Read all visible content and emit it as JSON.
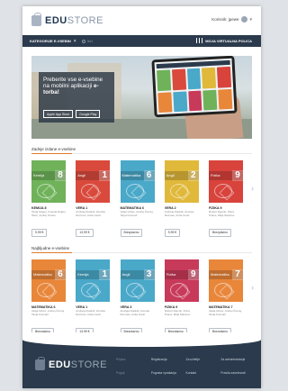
{
  "header": {
    "logo_edu": "EDU",
    "logo_store": "STORE",
    "user_name": "Korisnik: jpewe",
    "user_chevron": "▾"
  },
  "nav": {
    "categories_label": "KATEGORIJE E-VSEBIN",
    "categories_close": "×",
    "search_placeholder": "Išči",
    "shelf_label": "MOJA VIRTUALNA POLICA"
  },
  "hero": {
    "text_line": "Preberite vse e-vsebine na mobilni aplikaciji",
    "text_bold": "e-torba!",
    "btn_appstore": "Apple App Store",
    "btn_googleplay": "Google Play"
  },
  "sections": [
    {
      "title": "Zadnje izdane e-vsebine",
      "cards": [
        {
          "subject": "Kemija",
          "number": "8",
          "color": "#6fb25a",
          "title": "KEMIJA 8",
          "authors": "Tanja Gajser, Ksenija Doljan Šarić, Andrej Smrdu",
          "action": "9,99 €"
        },
        {
          "subject": "Angli",
          "number": "1",
          "color": "#d94a3c",
          "title": "VERA 1",
          "authors": "Andreja Kladnik, Zvonka Rozman, Anita Cerar",
          "action": "13,99 €"
        },
        {
          "subject": "Matematika",
          "number": "6",
          "color": "#4aa8c9",
          "title": "MATEMATIKA 6",
          "authors": "Vasja Grbec, Andrej Černej, Tanja Kosmač",
          "action": "Brezplačno"
        },
        {
          "subject": "Angli",
          "number": "2",
          "color": "#e0b83a",
          "title": "VERA 2",
          "authors": "Andreja Kladnik, Zvonka Rozman, Anita Cerar",
          "action": "9,99 €"
        },
        {
          "subject": "Fizika",
          "number": "9",
          "color": "#d8433c",
          "title": "FIZIKA 9",
          "authors": "Robert Repnik, Petra Knavs, Mitja Slavinec",
          "action": "Brezplačno"
        }
      ]
    },
    {
      "title": "Najbljudne e-vsebine",
      "cards": [
        {
          "subject": "Matematika",
          "number": "6",
          "color": "#e8863a",
          "title": "MATEMATIKA 6",
          "authors": "Vasja Grbec, Andrej Černej, Tanja Kosmač",
          "action": "Brezplačno"
        },
        {
          "subject": "Kemija",
          "number": "1",
          "color": "#4aa8c9",
          "title": "VERA 1",
          "authors": "Andreja Kladnik, Zvonka Rozman, Anita Cerar",
          "action": "13,99 €"
        },
        {
          "subject": "Angli",
          "number": "3",
          "color": "#4aa8c9",
          "title": "VERA 3",
          "authors": "Andreja Kladnik, Zvonka Rozman, Anita Cerar",
          "action": "Brezplačno"
        },
        {
          "subject": "Fizika",
          "number": "9",
          "color": "#c83a5a",
          "title": "FIZIKA 9",
          "authors": "Robert Repnik, Petra Knavs, Mitja Slavinec",
          "action": "Brezplačno"
        },
        {
          "subject": "Matematika",
          "number": "7",
          "color": "#e8863a",
          "title": "MATEMATIKA 7",
          "authors": "Vasja Grbec, Andrej Černej, Tanja Kosmač",
          "action": "Brezplačno"
        }
      ]
    }
  ],
  "footer": {
    "logo_edu": "EDU",
    "logo_store": "STORE",
    "links": [
      "Prijava",
      "Registracija",
      "Za učitelje",
      "Za administratorje",
      "Pogoji",
      "Pogosta vprašanja",
      "Kontakt",
      "Pravila zasebnosti"
    ]
  },
  "colors": {
    "nav_bg": "#2b3a4c",
    "accent": "#e07b2c"
  }
}
